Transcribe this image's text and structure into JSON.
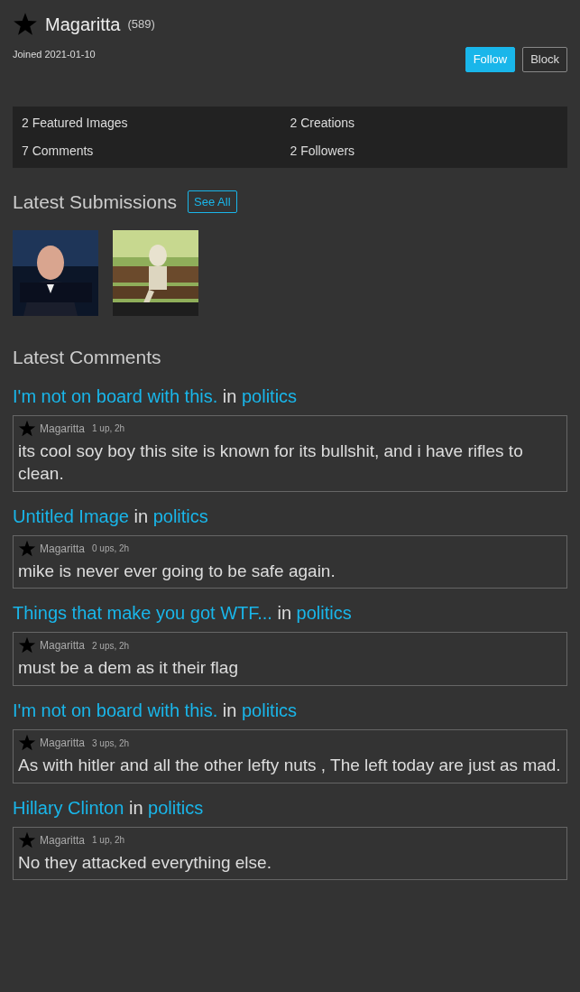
{
  "user": {
    "name": "Magaritta",
    "count": "(589)",
    "joined": "Joined 2021-01-10"
  },
  "actions": [
    {
      "label": "Follow",
      "kind": "primary"
    },
    {
      "label": "Block",
      "kind": "secondary"
    }
  ],
  "stats": [
    "2 Featured Images",
    "2 Creations",
    "7 Comments",
    "2 Followers"
  ],
  "submissions": {
    "title": "Latest Submissions",
    "see_all": "See All"
  },
  "comments": {
    "title": "Latest Comments",
    "items": [
      {
        "post": "I'm not on board with this.",
        "joiner": "in",
        "board": "politics",
        "author": "Magaritta",
        "meta": "1 up, 2h",
        "text": "its cool soy boy this site is known for its bullshit, and i have rifles to clean."
      },
      {
        "post": "Untitled Image",
        "joiner": "in",
        "board": "politics",
        "author": "Magaritta",
        "meta": "0 ups, 2h",
        "text": "mike is never ever going to be safe again."
      },
      {
        "post": "Things that make you got WTF...",
        "joiner": "in",
        "board": "politics",
        "author": "Magaritta",
        "meta": "2 ups, 2h",
        "text": "must be a dem as it their flag"
      },
      {
        "post": "I'm not on board with this.",
        "joiner": "in",
        "board": "politics",
        "author": "Magaritta",
        "meta": "3 ups, 2h",
        "text": "As with hitler and all the other lefty nuts , The left today are just as mad."
      },
      {
        "post": "Hillary Clinton",
        "joiner": "in",
        "board": "politics",
        "author": "Magaritta",
        "meta": "1 up, 2h",
        "text": "No they attacked everything else."
      }
    ]
  }
}
